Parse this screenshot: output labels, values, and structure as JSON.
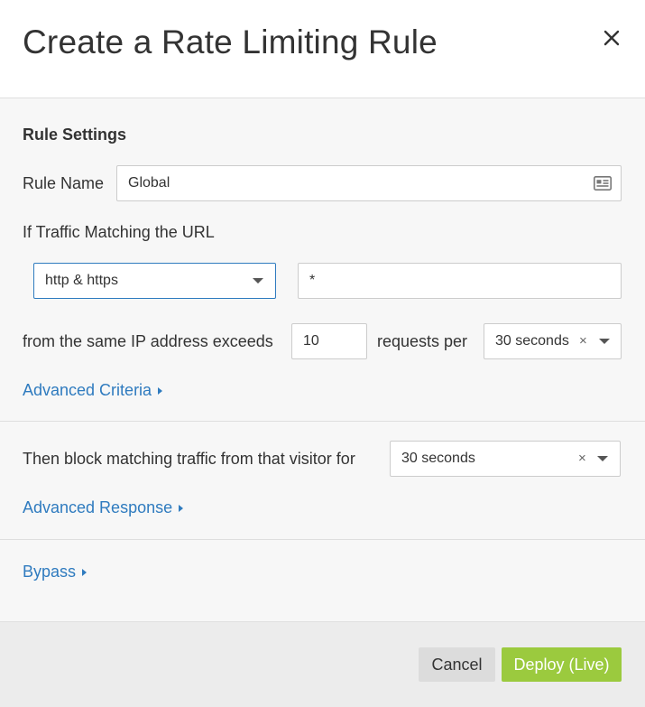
{
  "dialog": {
    "title": "Create a Rate Limiting Rule",
    "close_icon": "close-icon"
  },
  "rule_settings": {
    "heading": "Rule Settings",
    "rule_name_label": "Rule Name",
    "rule_name_value": "Global",
    "rule_name_icon": "contact-card-icon",
    "traffic_label": "If Traffic Matching the URL",
    "protocol_value": "http & https",
    "url_value": "*",
    "ip_label": "from the same IP address exceeds",
    "requests_value": "10",
    "requests_per_label": "requests per",
    "period_value": "30 seconds",
    "advanced_criteria": "Advanced Criteria"
  },
  "action": {
    "block_label": "Then block matching traffic from that visitor for",
    "duration_value": "30 seconds",
    "advanced_response": "Advanced Response"
  },
  "bypass": {
    "label": "Bypass"
  },
  "footer": {
    "cancel_label": "Cancel",
    "deploy_label": "Deploy (Live)"
  },
  "colors": {
    "link": "#2f7bbf",
    "deploy_button": "#9bca3e",
    "focus_border": "#2f7bbf"
  }
}
